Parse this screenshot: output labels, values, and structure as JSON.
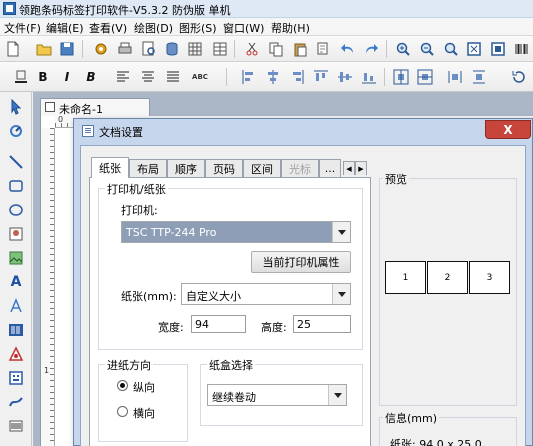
{
  "app": {
    "title": "领跑条码标签打印软件-V5.3.2 防伪版 单机"
  },
  "menu": [
    "文件(F)",
    "编辑(E)",
    "查看(V)",
    "绘图(D)",
    "图形(S)",
    "窗口(W)",
    "帮助(H)"
  ],
  "toolbar2": {
    "bold": "B",
    "italic": "I",
    "bold_italic": "B",
    "abc": "ABC"
  },
  "document": {
    "tab_label": "未命名-1",
    "ruler_top_zero": "0",
    "ruler_left_one": "1"
  },
  "dialog": {
    "title": "文档设置",
    "close_label": "X",
    "tabs": [
      {
        "label": "纸张",
        "active": true,
        "disabled": false
      },
      {
        "label": "布局",
        "active": false,
        "disabled": false
      },
      {
        "label": "顺序",
        "active": false,
        "disabled": false
      },
      {
        "label": "页码",
        "active": false,
        "disabled": false
      },
      {
        "label": "区间",
        "active": false,
        "disabled": false
      },
      {
        "label": "光标",
        "active": false,
        "disabled": true
      },
      {
        "label": "...",
        "active": false,
        "disabled": false
      }
    ],
    "printer_group": {
      "title": "打印机/纸张",
      "printer_label": "打印机:",
      "printer_value": "TSC TTP-244 Pro",
      "properties_button": "当前打印机属性",
      "paper_label": "纸张(mm):",
      "paper_value": "自定义大小",
      "width_label": "宽度:",
      "width_value": "94",
      "height_label": "高度:",
      "height_value": "25"
    },
    "feed_group": {
      "title": "进纸方向",
      "options": [
        {
          "label": "纵向",
          "checked": true
        },
        {
          "label": "横向",
          "checked": false
        }
      ]
    },
    "tray_group": {
      "title": "纸盒选择",
      "value": "继续卷动"
    },
    "preview": {
      "title": "预览",
      "labels": [
        "1",
        "2",
        "3"
      ]
    },
    "info": {
      "title": "信息(mm)",
      "paper_text": "纸张: 94.0 x 25.0"
    }
  }
}
